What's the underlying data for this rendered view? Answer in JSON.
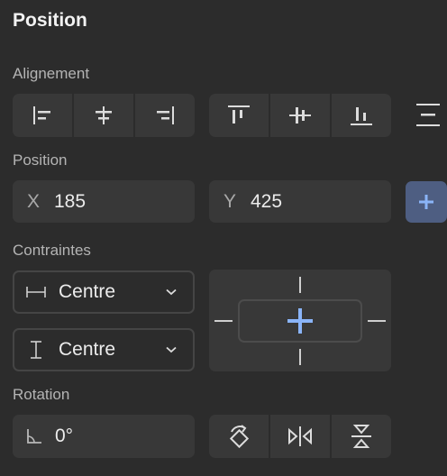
{
  "panel": {
    "title": "Position"
  },
  "alignment": {
    "label": "Alignement",
    "buttons": [
      "align-left-icon",
      "align-center-h-icon",
      "align-right-icon",
      "align-top-icon",
      "align-center-v-icon",
      "align-bottom-icon",
      "distribute-icon"
    ]
  },
  "position": {
    "label": "Position",
    "x_label": "X",
    "x_value": "185",
    "y_label": "Y",
    "y_value": "425",
    "add_icon": "plus-icon"
  },
  "constraints": {
    "label": "Contraintes",
    "horizontal": {
      "value": "Centre",
      "icon": "horizontal-constraint-icon"
    },
    "vertical": {
      "value": "Centre",
      "icon": "vertical-constraint-icon"
    }
  },
  "rotation": {
    "label": "Rotation",
    "value": "0°",
    "buttons": [
      "rotate-icon",
      "flip-horizontal-icon",
      "flip-vertical-icon"
    ]
  },
  "colors": {
    "accent": "#8ab4f8",
    "panel_bg": "#2c2c2c",
    "control_bg": "#383838"
  }
}
